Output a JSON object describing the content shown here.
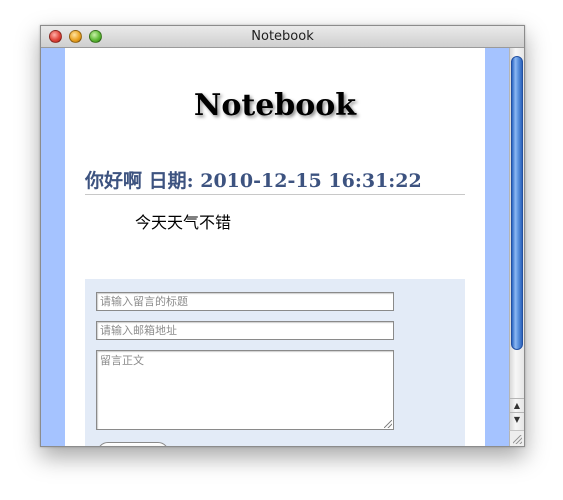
{
  "window": {
    "title": "Notebook"
  },
  "page": {
    "heading": "Notebook",
    "entry": {
      "title": "你好啊 日期: 2010-12-15 16:31:22",
      "body": "今天天气不错"
    },
    "form": {
      "title_placeholder": "请输入留言的标题",
      "email_placeholder": "请输入邮箱地址",
      "body_placeholder": "留言正文"
    }
  },
  "colors": {
    "side_background": "#a5c3ff",
    "form_panel": "#e3ebf7",
    "entry_title": "#3d5380",
    "scroll_thumb": "#4a82d6"
  },
  "icons": {
    "scroll_up": "▲",
    "scroll_down": "▼"
  }
}
